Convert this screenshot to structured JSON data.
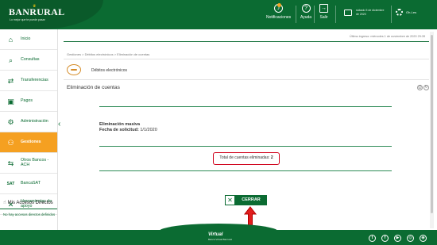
{
  "header": {
    "logo_text": "BANRURAL",
    "logo_slogan": "Lo mejor que te puede pasar",
    "notifications_label": "Notificaciones",
    "help_label": "Ayuda",
    "logout_label": "Salir",
    "last_access_text": "sábado 5 de diciembre de 2020",
    "greeting": "Oh-l-es"
  },
  "sidebar": {
    "items": [
      {
        "label": "Inicio",
        "icon": "house-icon"
      },
      {
        "label": "Consultas",
        "icon": "search-icon"
      },
      {
        "label": "Transferencias",
        "icon": "transfer-icon"
      },
      {
        "label": "Pagos",
        "icon": "cash-icon"
      },
      {
        "label": "Administración",
        "icon": "gear-icon"
      },
      {
        "label": "Gestiones",
        "icon": "people-icon",
        "active": true
      },
      {
        "label": "Otros Bancos - ACH",
        "icon": "bank-icon"
      },
      {
        "label": "BancaSAT",
        "icon": "sat-icon"
      },
      {
        "label": "Herramientas de apoyo",
        "icon": "tools-icon"
      }
    ],
    "mis_accesos_title": "Mis Accesos Directos",
    "mis_accesos_empty": "No hay accesos directos definidos"
  },
  "main": {
    "last_login": "Último ingreso: miércoles 1 de noviembre de 2020 29:39",
    "breadcrumb": "Gestiones > Débitos electrónicos > Eliminación de cuentas",
    "module_title": "Débitos electrónicos",
    "section_title": "Eliminación de cuentas",
    "info_title": "Eliminación masiva",
    "info_date_label": "Fecha de solicitud:",
    "info_date_value": "1/1/2020",
    "total_label": "Total de cuentas eliminadas:",
    "total_value": "2",
    "close_button": "CERRAR",
    "close_icon_glyph": "✕"
  },
  "footer": {
    "logo_text": "Virtual",
    "logo_sub": "Banca Virtual Banrural",
    "social": [
      {
        "glyph": "t",
        "icon": "twitter-icon"
      },
      {
        "glyph": "f",
        "icon": "facebook-icon"
      },
      {
        "glyph": "▶",
        "icon": "youtube-icon"
      },
      {
        "glyph": "◎",
        "icon": "instagram-icon"
      },
      {
        "glyph": "◉",
        "icon": "whatsapp-icon"
      }
    ]
  },
  "colors": {
    "brand_green": "#0b6b32",
    "active_orange": "#f5a021",
    "highlight_red": "#d0021b"
  }
}
